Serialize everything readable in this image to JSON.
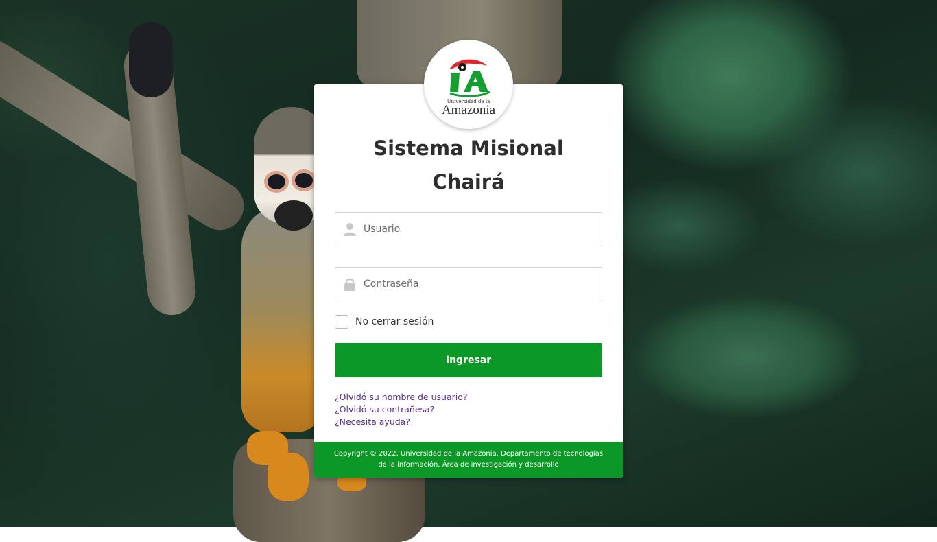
{
  "logo": {
    "alt": "Universidad de la Amazonia logo",
    "line1": "Universidad de la",
    "line2": "Amazonia",
    "colors": {
      "red": "#e0262b",
      "green": "#13a02e"
    }
  },
  "title": {
    "line1": "Sistema Misional",
    "line2": "Chairá"
  },
  "form": {
    "username": {
      "placeholder": "Usuario",
      "value": "",
      "icon": "user-icon"
    },
    "password": {
      "placeholder": "Contraseña",
      "value": "",
      "icon": "lock-icon"
    },
    "remember": {
      "label": "No cerrar sesión",
      "checked": false
    },
    "submit_label": "Ingresar"
  },
  "links": [
    "¿Olvidó su nombre de usuario?",
    "¿Olvidó su contrañesa?",
    "¿Necesita ayuda?"
  ],
  "footer": {
    "line1": "Copyright © 2022. Universidad de la Amazonia. Departamento de tecnologías",
    "line2": "de la información. Área de investigación y desarrollo"
  },
  "colors": {
    "accent": "#0c9826",
    "link": "#5a2f8e",
    "title": "#2e2e2e"
  }
}
